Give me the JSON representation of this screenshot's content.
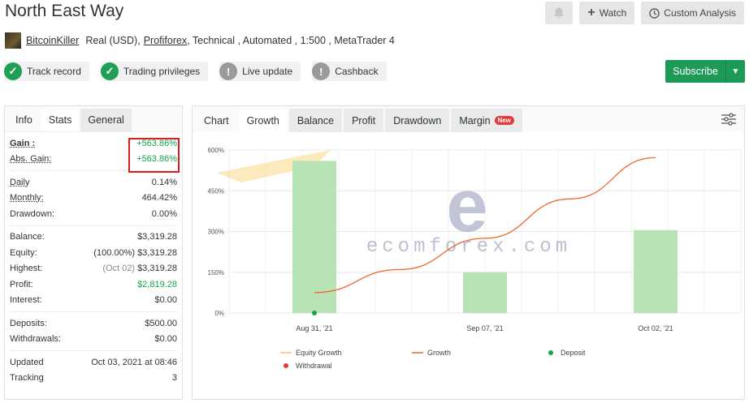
{
  "header": {
    "title": "North East Way",
    "watch_label": "Watch",
    "custom_analysis_label": "Custom Analysis"
  },
  "subline": {
    "user": "BitcoinKiller",
    "account": "Real (USD),",
    "broker": "Profiforex",
    "details": ", Technical , Automated , 1:500 , MetaTrader 4"
  },
  "badges": [
    {
      "label": "Track record",
      "status": "ok"
    },
    {
      "label": "Trading privileges",
      "status": "ok"
    },
    {
      "label": "Live update",
      "status": "warn"
    },
    {
      "label": "Cashback",
      "status": "warn"
    }
  ],
  "subscribe_label": "Subscribe",
  "left_tabs": [
    "Info",
    "Stats",
    "General"
  ],
  "stats": {
    "gain": {
      "label": "Gain :",
      "value": "+563.86%"
    },
    "abs_gain": {
      "label": "Abs. Gain:",
      "value": "+563.86%"
    },
    "daily": {
      "label": "Daily",
      "value": "0.14%"
    },
    "monthly": {
      "label": "Monthly:",
      "value": "464.42%"
    },
    "drawdown": {
      "label": "Drawdown:",
      "value": "0.00%"
    },
    "balance": {
      "label": "Balance:",
      "value": "$3,319.28"
    },
    "equity": {
      "label": "Equity:",
      "note": "(100.00%)",
      "value": "$3,319.28"
    },
    "highest": {
      "label": "Highest:",
      "note": "(Oct 02)",
      "value": "$3,319.28"
    },
    "profit": {
      "label": "Profit:",
      "value": "$2,819.28"
    },
    "interest": {
      "label": "Interest:",
      "value": "$0.00"
    },
    "deposits": {
      "label": "Deposits:",
      "value": "$500.00"
    },
    "withdrawals": {
      "label": "Withdrawals:",
      "value": "$0.00"
    },
    "updated": {
      "label": "Updated",
      "value": "Oct 03, 2021 at 08:46"
    },
    "tracking": {
      "label": "Tracking",
      "value": "3"
    }
  },
  "right_tabs": [
    "Chart",
    "Growth",
    "Balance",
    "Profit",
    "Drawdown",
    "Margin"
  ],
  "new_tag": "New",
  "watermark": {
    "brand": "ecomforex.com"
  },
  "colors": {
    "accent_green": "#1e9a58",
    "bar": "#b7e3b5",
    "growth_line": "#f0662a",
    "equity_line": "#f3c55a",
    "deposit": "#16a34a",
    "withdrawal": "#e53935"
  },
  "chart_data": {
    "type": "bar",
    "categories": [
      "Aug 31, '21",
      "Sep 07, '21",
      "Oct 02, '21"
    ],
    "series": [
      {
        "name": "Growth",
        "type": "bar",
        "values": [
          560,
          150,
          305
        ]
      },
      {
        "name": "Growth",
        "type": "line",
        "x": [
          0,
          0.5,
          1,
          1.5,
          2
        ],
        "values": [
          75,
          160,
          275,
          420,
          572
        ]
      }
    ],
    "deposit_points": [
      {
        "category": "Aug 31, '21",
        "value": 0
      }
    ],
    "yticks": [
      "0%",
      "150%",
      "300%",
      "450%",
      "600%"
    ],
    "ylim": [
      0,
      600
    ],
    "grid": true,
    "legend": [
      "Equity Growth",
      "Growth",
      "Deposit",
      "Withdrawal"
    ],
    "legend_position": "bottom"
  }
}
